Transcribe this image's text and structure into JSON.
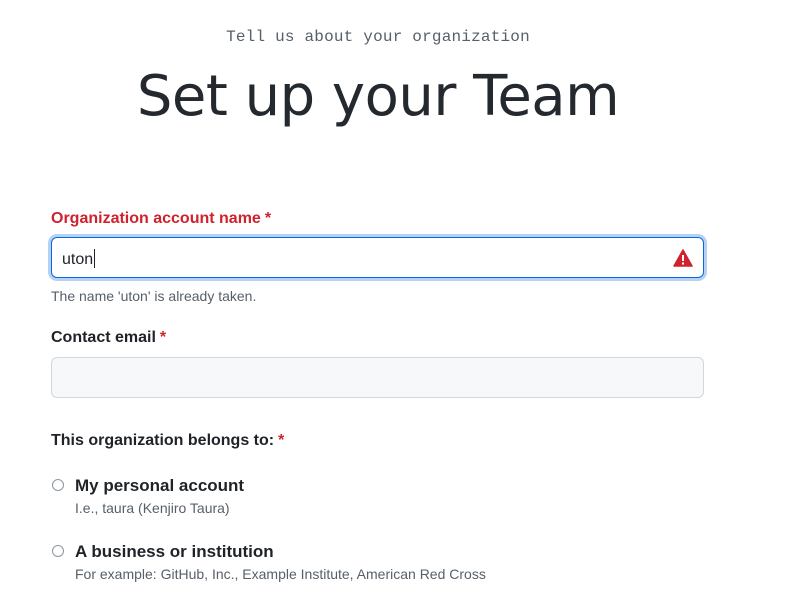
{
  "header": {
    "eyebrow": "Tell us about your organization",
    "title": "Set up your Team"
  },
  "form": {
    "org_name": {
      "label": "Organization account name",
      "required_mark": "*",
      "value": "uton",
      "state": "error",
      "status_icon": "alert-triangle-icon",
      "error_message": "The name 'uton' is already taken."
    },
    "email": {
      "label": "Contact email",
      "required_mark": "*",
      "value": ""
    },
    "belongs_to": {
      "label": "This organization belongs to:",
      "required_mark": "*",
      "options": [
        {
          "title": "My personal account",
          "description": "I.e., taura (Kenjiro Taura)"
        },
        {
          "title": "A business or institution",
          "description": "For example: GitHub, Inc., Example Institute, American Red Cross"
        }
      ]
    }
  },
  "colors": {
    "error_red": "#cf222e",
    "focus_blue": "#0969da",
    "muted_text": "#57606a"
  }
}
